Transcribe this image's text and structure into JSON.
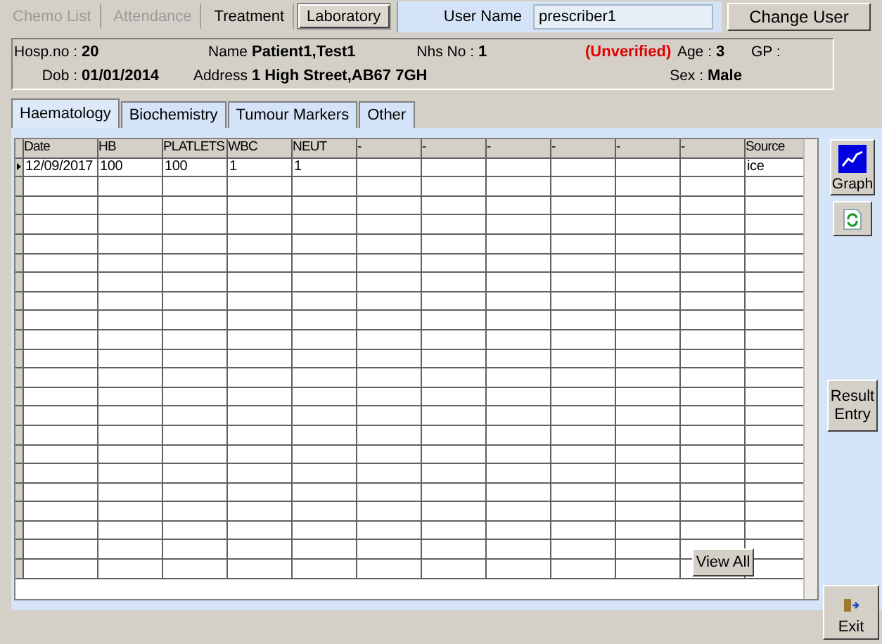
{
  "top_tabs": [
    {
      "label": "Chemo List",
      "selected": false,
      "disabled": true
    },
    {
      "label": "Attendance",
      "selected": false,
      "disabled": true
    },
    {
      "label": "Treatment",
      "selected": false,
      "disabled": false
    },
    {
      "label": "Laboratory",
      "selected": true,
      "disabled": false
    }
  ],
  "user": {
    "label": "User Name",
    "value": "prescriber1"
  },
  "change_user_button": "Change User",
  "patient": {
    "hosp_no": {
      "label": "Hosp.no :",
      "value": "20"
    },
    "name": {
      "label": "Name",
      "value": "Patient1,Test1"
    },
    "nhs_no": {
      "label": "Nhs No :",
      "value": "1"
    },
    "status": "(Unverified)",
    "age": {
      "label": "Age :",
      "value": "3"
    },
    "gp": {
      "label": "GP :"
    },
    "dob": {
      "label": "Dob :",
      "value": "01/01/2014"
    },
    "address": {
      "label": "Address",
      "value": "1 High Street,AB67 7GH"
    },
    "sex": {
      "label": "Sex :",
      "value": "Male"
    }
  },
  "result_tabs": [
    {
      "label": "Haematology",
      "selected": true
    },
    {
      "label": "Biochemistry",
      "selected": false
    },
    {
      "label": "Tumour Markers",
      "selected": false
    },
    {
      "label": "Other",
      "selected": false
    }
  ],
  "table": {
    "columns": [
      "Date",
      "HB",
      "PLATLETS",
      "WBC",
      "NEUT",
      "-",
      "-",
      "-",
      "-",
      "-",
      "-",
      "Source"
    ],
    "rows": [
      {
        "current": true,
        "cells": [
          "12/09/2017",
          "100",
          "100",
          "1",
          "1",
          "",
          "",
          "",
          "",
          "",
          "",
          "ice"
        ]
      }
    ]
  },
  "graph_button": "Graph",
  "result_entry_button": "Result Entry",
  "view_all_button": "View All",
  "exit_button": "Exit"
}
